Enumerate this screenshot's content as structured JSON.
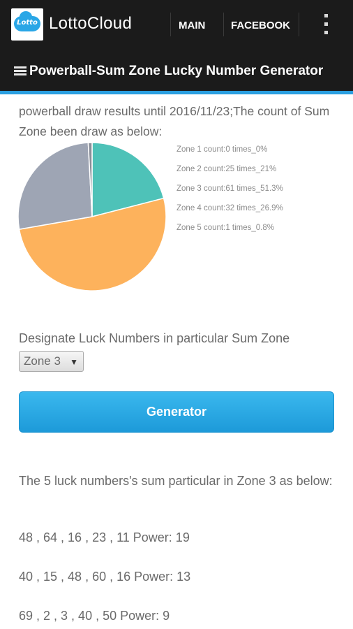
{
  "app": {
    "name": "LottoCloud",
    "logo_text": "Lotto"
  },
  "nav": {
    "main": "MAIN",
    "facebook": "FACEBOOK"
  },
  "page": {
    "title": "Powerball-Sum Zone Lucky Number Generator"
  },
  "stats": {
    "intro": "powerball draw results until 2016/11/23;The count of Sum Zone been draw as below:"
  },
  "chart_data": {
    "type": "pie",
    "slices": [
      {
        "label": "Zone 1 count:0 times_0%",
        "value": 0,
        "color": "#6b6b6b"
      },
      {
        "label": "Zone 2 count:25 times_21%",
        "value": 25,
        "color": "#4ec2b8"
      },
      {
        "label": "Zone 3 count:61 times_51.3%",
        "value": 61,
        "color": "#fdb25c"
      },
      {
        "label": "Zone 4 count:32 times_26.9%",
        "value": 32,
        "color": "#9ea5b4"
      },
      {
        "label": "Zone 5 count:1 times_0.8%",
        "value": 1,
        "color": "#8a8f99"
      }
    ]
  },
  "designate": {
    "label": "Designate Luck Numbers in particular Sum Zone",
    "selected_zone": "Zone 3"
  },
  "generator": {
    "button_label": "Generator"
  },
  "results": {
    "intro": "The 5 luck numbers's sum particular in Zone 3 as below:",
    "rows": [
      "48 , 64 , 16 , 23 , 11 Power: 19",
      "40 , 15 , 48 , 60 , 16 Power: 13",
      "69 , 2 , 3 , 40 , 50 Power: 9"
    ]
  }
}
